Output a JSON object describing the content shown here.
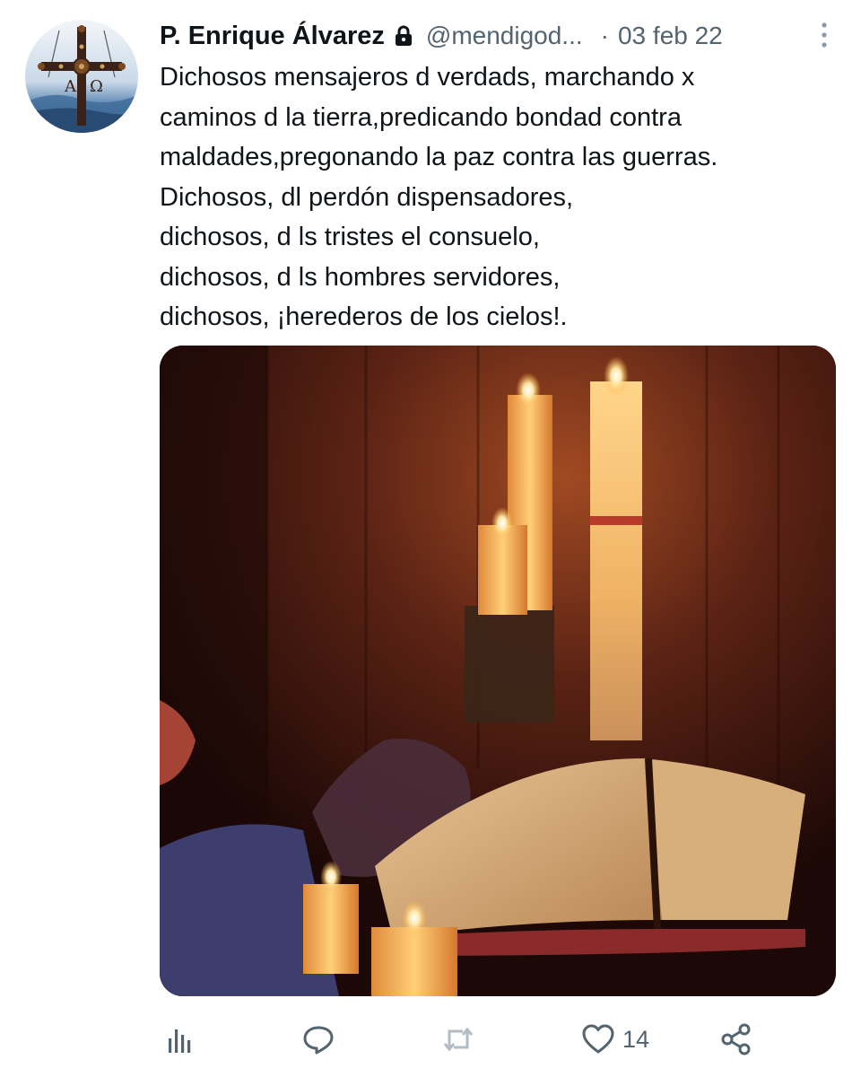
{
  "tweet": {
    "author": {
      "display_name": "P. Enrique Álvarez",
      "handle": "@mendigod...",
      "avatar_letters": [
        "A",
        "Ω"
      ],
      "protected_icon": "lock-icon"
    },
    "separator": "·",
    "date": "03 feb 22",
    "text_lines": [
      "Dichosos mensajeros d verdads, marchando x",
      "caminos d la tierra,predicando bondad contra",
      "maldades,pregonando la paz contra las guerras.",
      "Dichosos, dl perdón dispensadores,",
      "dichosos, d ls tristes el consuelo,",
      "dichosos, d ls hombres servidores,",
      "dichosos, ¡herederos de los cielos!."
    ],
    "media": {
      "icon": "candlelit-altar-photo"
    },
    "actions": {
      "views_icon": "bar-chart-icon",
      "reply_icon": "reply-icon",
      "retweet_icon": "retweet-icon",
      "like_icon": "heart-icon",
      "like_count": "14",
      "share_icon": "share-icon"
    },
    "colors": {
      "text": "#0f1419",
      "secondary": "#536471",
      "retweet_disabled": "#b0bcc6"
    }
  }
}
